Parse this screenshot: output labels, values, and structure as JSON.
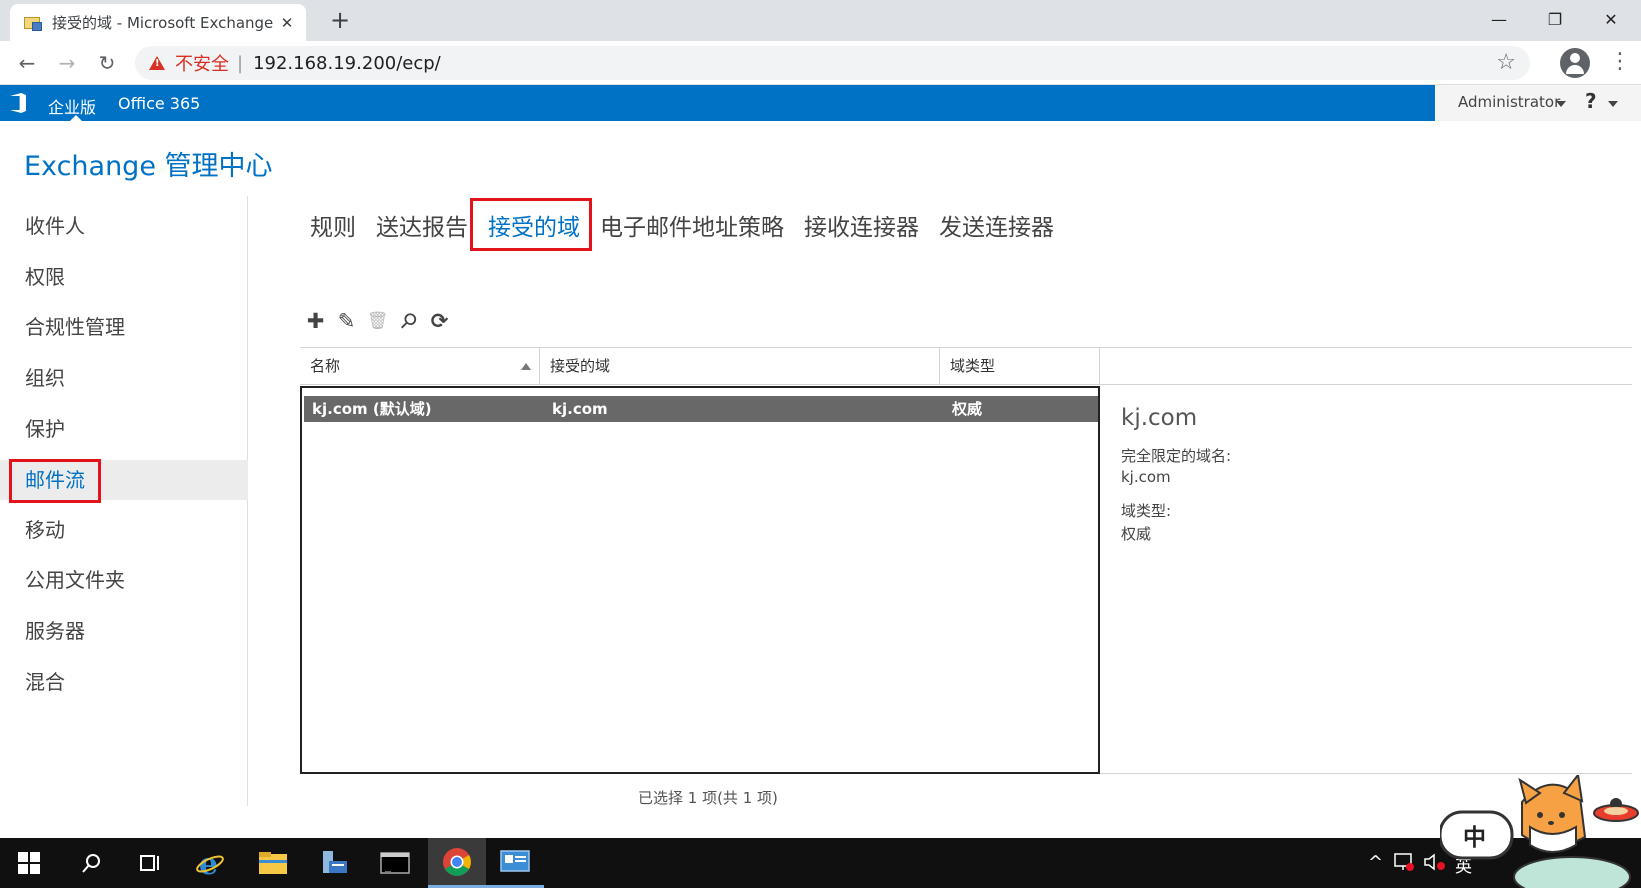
{
  "browser": {
    "tab_title": "接受的域 - Microsoft Exchange",
    "tab_close": "✕",
    "new_tab": "+",
    "win_min": "—",
    "win_max": "❐",
    "win_close": "✕",
    "back": "←",
    "forward": "→",
    "reload": "↻",
    "insecure_label": "不安全",
    "separator": "|",
    "url": "192.168.19.200/ecp/",
    "star": "☆",
    "menu": "⋮"
  },
  "officebar": {
    "edition": "企业版",
    "office365": "Office 365",
    "user": "Administrator",
    "help": "?"
  },
  "eac": {
    "title": "Exchange 管理中心"
  },
  "leftnav": {
    "items": [
      {
        "label": "收件人"
      },
      {
        "label": "权限"
      },
      {
        "label": "合规性管理"
      },
      {
        "label": "组织"
      },
      {
        "label": "保护"
      },
      {
        "label": "邮件流"
      },
      {
        "label": "移动"
      },
      {
        "label": "公用文件夹"
      },
      {
        "label": "服务器"
      },
      {
        "label": "混合"
      }
    ],
    "active_index": 5
  },
  "tabs": [
    {
      "label": "规则"
    },
    {
      "label": "送达报告"
    },
    {
      "label": "接受的域"
    },
    {
      "label": "电子邮件地址策略"
    },
    {
      "label": "接收连接器"
    },
    {
      "label": "发送连接器"
    }
  ],
  "actions": [
    {
      "icon": "add-icon",
      "glyph": "✚"
    },
    {
      "icon": "edit-icon",
      "glyph": "✎"
    },
    {
      "icon": "delete-icon",
      "glyph": "🗑"
    },
    {
      "icon": "search-icon",
      "glyph": "⚲"
    },
    {
      "icon": "refresh-icon",
      "glyph": "⟳"
    }
  ],
  "grid": {
    "columns": [
      "名称",
      "接受的域",
      "域类型"
    ],
    "rows": [
      {
        "name": "kj.com (默认域)",
        "domain": "kj.com",
        "type": "权威"
      }
    ],
    "status": "已选择 1 项(共 1 项)"
  },
  "details": {
    "title": "kj.com",
    "fqdn_label": "完全限定的域名:",
    "fqdn_value": "kj.com",
    "type_label": "域类型:",
    "type_value": "权威"
  },
  "taskbar": {
    "ime_label": "英",
    "mascot_label": "中"
  },
  "colors": {
    "accent": "#0072c6",
    "highlight": "#e3131b",
    "selected_row": "#686868"
  }
}
